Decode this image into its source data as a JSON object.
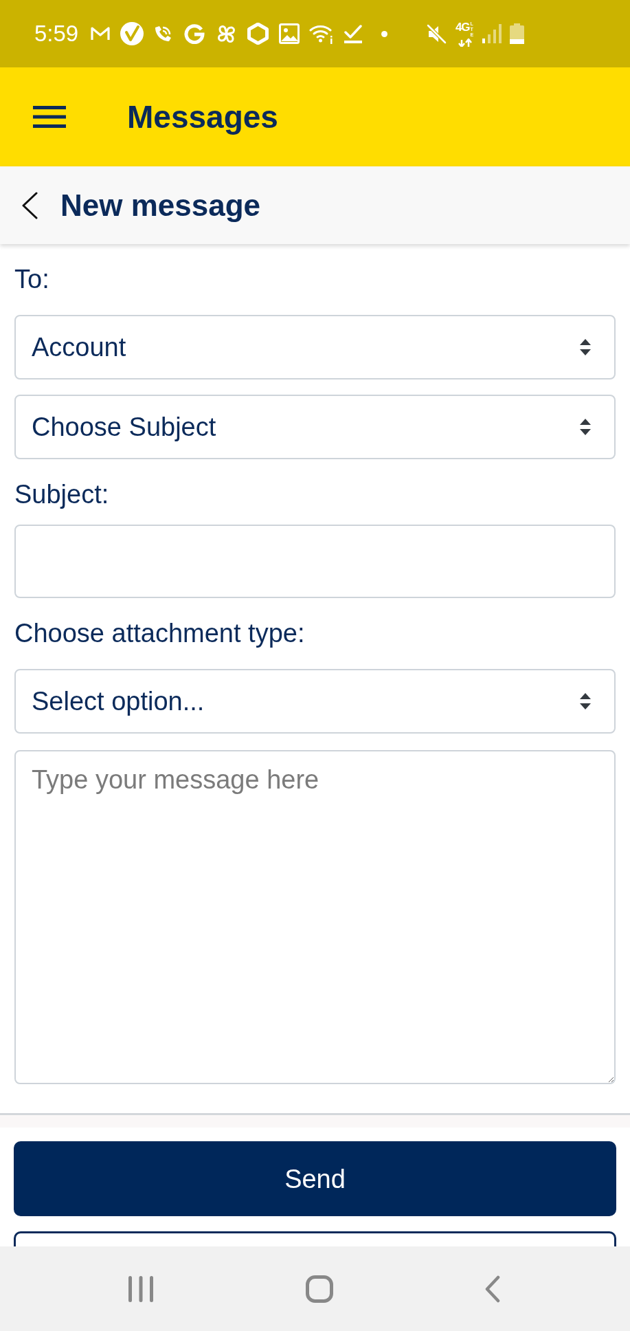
{
  "status_bar": {
    "time": "5:59",
    "network_type": "4G",
    "network_subtype": "LTE"
  },
  "app_bar": {
    "title": "Messages"
  },
  "page_header": {
    "title": "New message"
  },
  "form": {
    "fields": [
      {
        "kind": "label",
        "text": "To:"
      },
      {
        "kind": "select",
        "value": "Account"
      },
      {
        "kind": "select",
        "value": "Choose Subject"
      },
      {
        "kind": "label",
        "text": "Subject:"
      },
      {
        "kind": "input"
      },
      {
        "kind": "label",
        "text": "Choose attachment type:"
      },
      {
        "kind": "select",
        "value": "Select option..."
      },
      {
        "kind": "textarea",
        "placeholder": "Type your message here"
      }
    ]
  },
  "buttons": [
    {
      "kind": "primary",
      "label": "Send"
    },
    {
      "kind": "outline"
    }
  ]
}
